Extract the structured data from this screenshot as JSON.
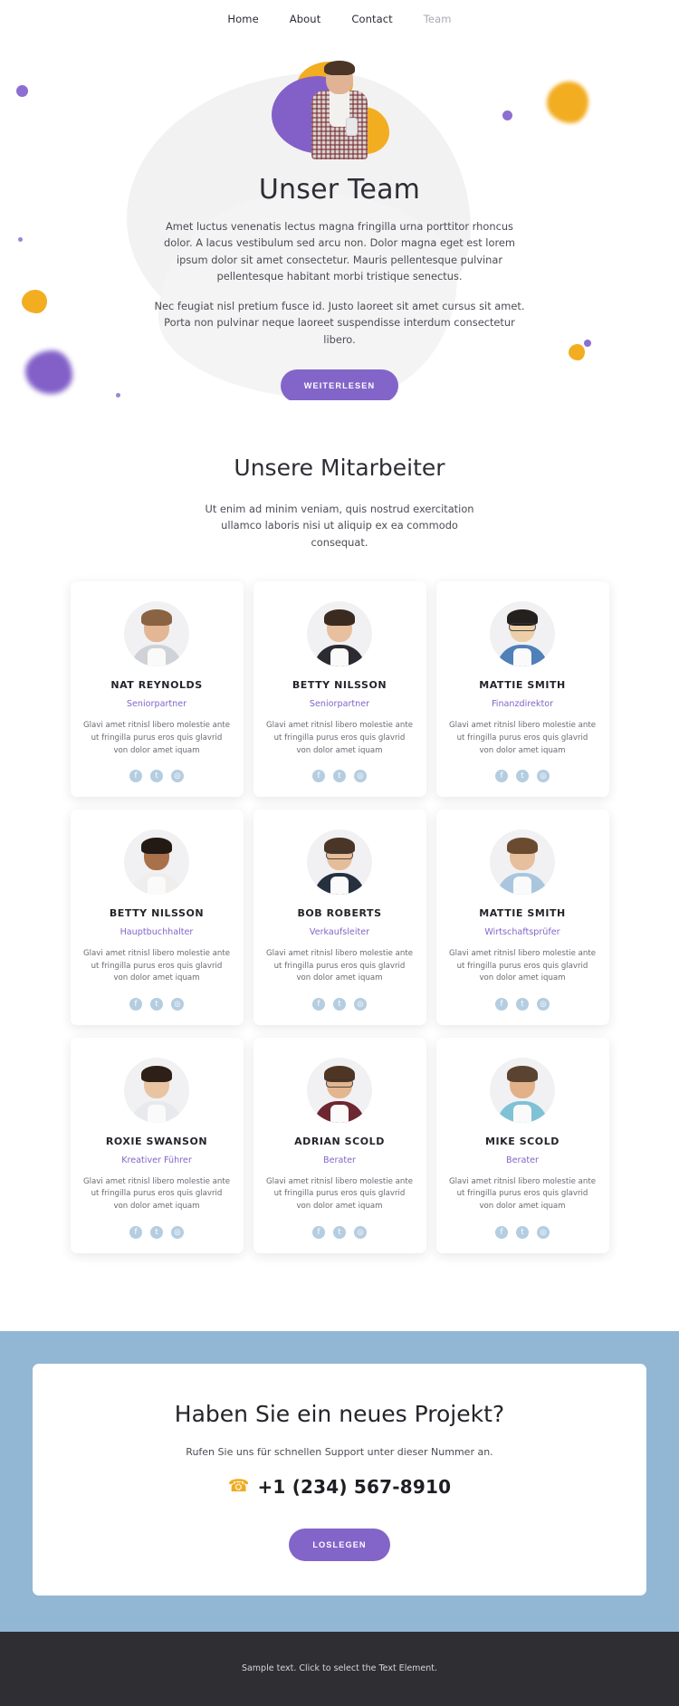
{
  "nav": {
    "items": [
      {
        "label": "Home",
        "active": false
      },
      {
        "label": "About",
        "active": false
      },
      {
        "label": "Contact",
        "active": false
      },
      {
        "label": "Team",
        "active": true
      }
    ]
  },
  "hero": {
    "title": "Unser Team",
    "paragraph1": "Amet luctus venenatis lectus magna fringilla urna porttitor rhoncus dolor. A lacus vestibulum sed arcu non. Dolor magna eget est lorem ipsum dolor sit amet consectetur. Mauris pellentesque pulvinar pellentesque habitant morbi tristique senectus.",
    "paragraph2": "Nec feugiat nisl pretium fusce id. Justo laoreet sit amet cursus sit amet. Porta non pulvinar neque laoreet suspendisse interdum consectetur libero.",
    "button_label": "WEITERLESEN"
  },
  "team": {
    "heading": "Unsere Mitarbeiter",
    "subheading": "Ut enim ad minim veniam, quis nostrud exercitation ullamco laboris nisi ut aliquip ex ea commodo consequat.",
    "description": "Glavi amet ritnisl libero molestie ante ut fringilla purus eros quis glavrid von dolor amet iquam",
    "social_icons": [
      "facebook-icon",
      "twitter-icon",
      "instagram-icon"
    ],
    "members": [
      {
        "name": "NAT REYNOLDS",
        "role": "Seniorpartner",
        "skin": "#e3b695",
        "hair": "#8a6342",
        "body": "#cfd2d6",
        "glasses": false
      },
      {
        "name": "BETTY NILSSON",
        "role": "Seniorpartner",
        "skin": "#e8c0a0",
        "hair": "#3b2a20",
        "body": "#2b2b31",
        "glasses": false
      },
      {
        "name": "MATTIE SMITH",
        "role": "Finanzdirektor",
        "skin": "#eccfa8",
        "hair": "#23201d",
        "body": "#4f80b8",
        "glasses": true
      },
      {
        "name": "BETTY NILSSON",
        "role": "Hauptbuchhalter",
        "skin": "#a9714a",
        "hair": "#241a14",
        "body": "#f0eeec",
        "glasses": false
      },
      {
        "name": "BOB ROBERTS",
        "role": "Verkaufsleiter",
        "skin": "#e6bd99",
        "hair": "#4a3526",
        "body": "#26303f",
        "glasses": true
      },
      {
        "name": "MATTIE SMITH",
        "role": "Wirtschaftsprüfer",
        "skin": "#e7bf9c",
        "hair": "#6b4b2f",
        "body": "#a9c6de",
        "glasses": false
      },
      {
        "name": "ROXIE SWANSON",
        "role": "Kreativer Führer",
        "skin": "#e9c4a2",
        "hair": "#2e2016",
        "body": "#e8e9ec",
        "glasses": false
      },
      {
        "name": "ADRIAN SCOLD",
        "role": "Berater",
        "skin": "#e3b68f",
        "hair": "#4e3524",
        "body": "#6c2730",
        "glasses": true
      },
      {
        "name": "MIKE SCOLD",
        "role": "Berater",
        "skin": "#e2b189",
        "hair": "#5a4330",
        "body": "#7fc2d6",
        "glasses": false
      }
    ]
  },
  "cta": {
    "heading": "Haben Sie ein neues Projekt?",
    "lead": "Rufen Sie uns für schnellen Support unter dieser Nummer an.",
    "phone": "+1 (234) 567-8910",
    "phone_icon": "phone-icon",
    "button_label": "LOSLEGEN"
  },
  "footer": {
    "text": "Sample text. Click to select the Text Element."
  },
  "colors": {
    "accent_purple": "#8365c9",
    "accent_yellow": "#f0ab1f",
    "band_blue": "#92b7d4",
    "footer_dark": "#2e2e33",
    "social_blue": "#b5cde0"
  }
}
